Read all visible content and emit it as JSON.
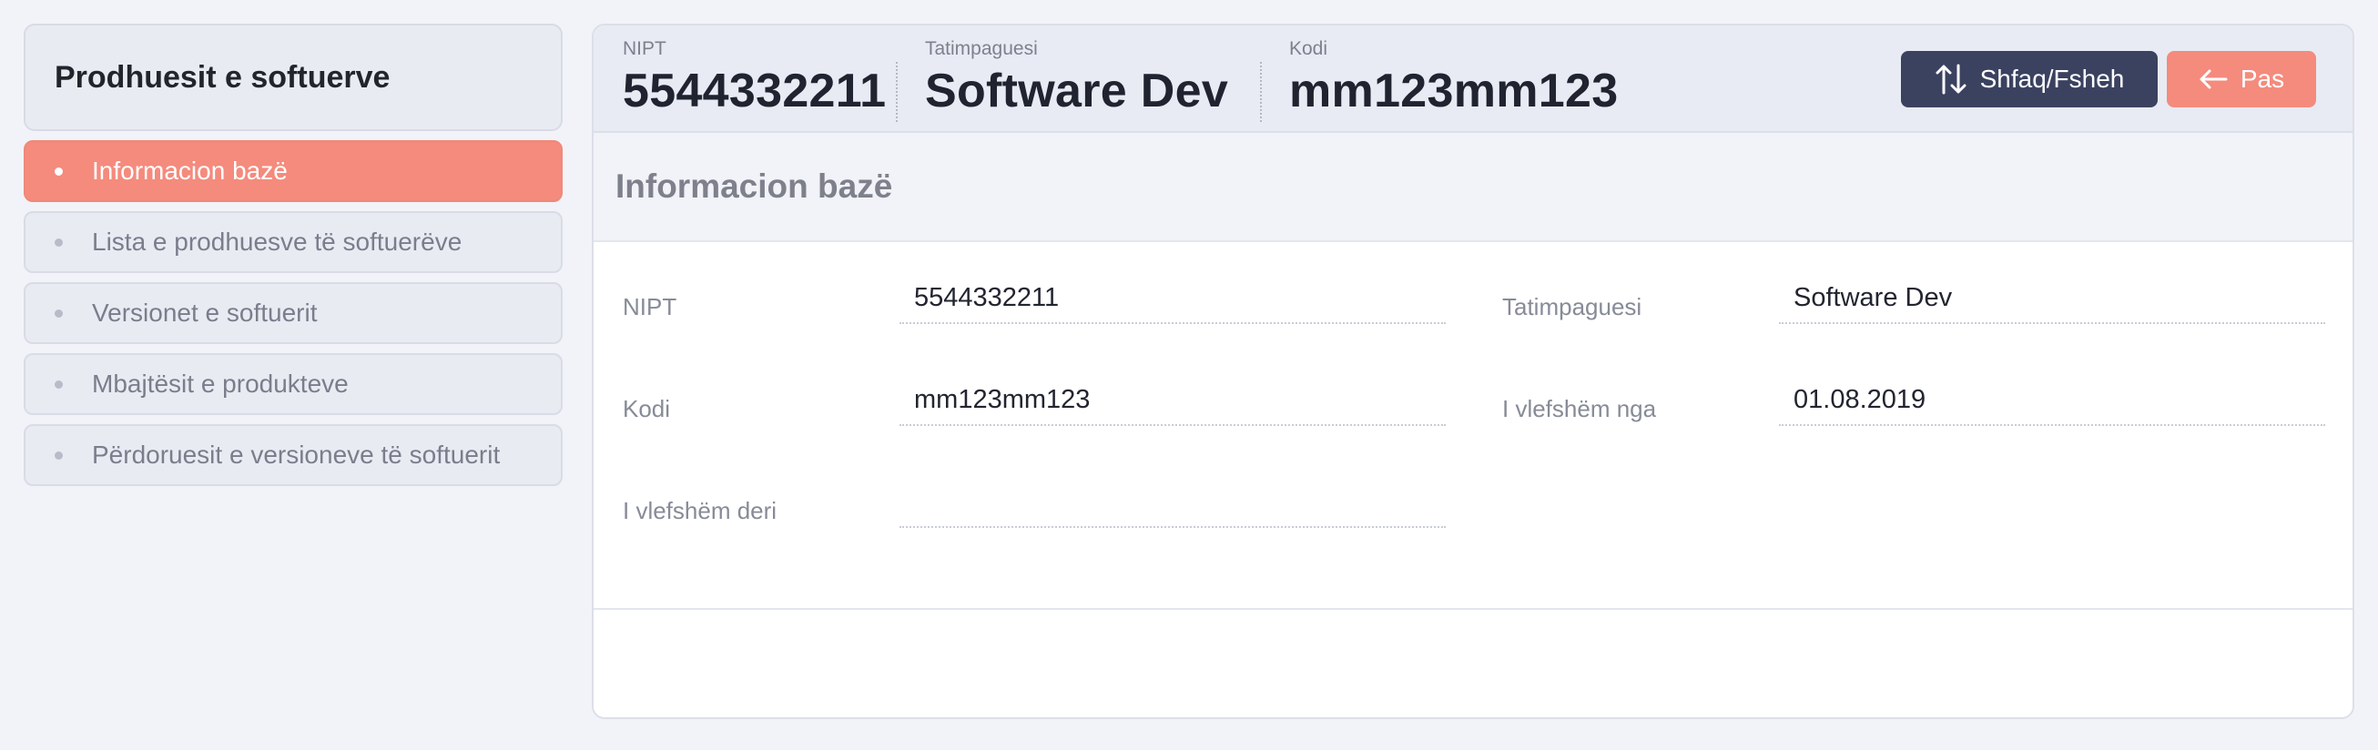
{
  "sidebar": {
    "title": "Prodhuesit e softuerve",
    "items": [
      {
        "label": "Informacion bazë",
        "active": true
      },
      {
        "label": "Lista e prodhuesve të softuerëve",
        "active": false
      },
      {
        "label": "Versionet e softuerit",
        "active": false
      },
      {
        "label": "Mbajtësit e produkteve",
        "active": false
      },
      {
        "label": "Përdoruesit e versioneve të softuerit",
        "active": false
      }
    ]
  },
  "header": {
    "fields": [
      {
        "caption": "NIPT",
        "value": "5544332211"
      },
      {
        "caption": "Tatimpaguesi",
        "value": "Software Dev"
      },
      {
        "caption": "Kodi",
        "value": "mm123mm123"
      }
    ],
    "toggle_button": {
      "label": "Shfaq/Fsheh",
      "icon": "sort-arrows-icon"
    },
    "back_button": {
      "label": "Pas",
      "icon": "arrow-left-icon"
    }
  },
  "section": {
    "title": "Informacion bazë"
  },
  "form": {
    "nipt": {
      "label": "NIPT",
      "value": "5544332211"
    },
    "tatimpaguesi": {
      "label": "Tatimpaguesi",
      "value": "Software Dev"
    },
    "kodi": {
      "label": "Kodi",
      "value": "mm123mm123"
    },
    "valid_from": {
      "label": "I vlefshëm nga",
      "value": "01.08.2019"
    },
    "valid_to": {
      "label": "I vlefshëm deri",
      "value": ""
    }
  },
  "colors": {
    "accent": "#f48b7d",
    "dark_button": "#3b4260",
    "background": "#f1f3f8"
  }
}
